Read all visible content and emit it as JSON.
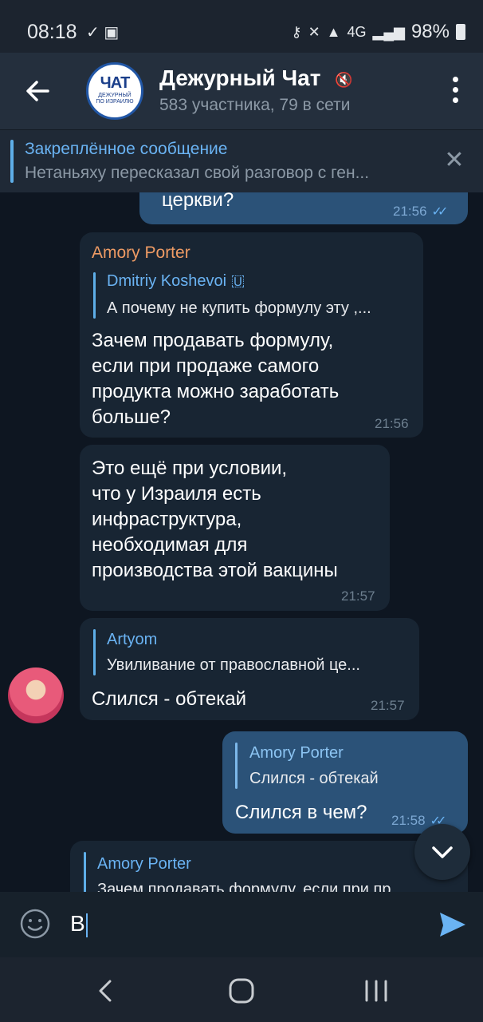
{
  "status": {
    "time": "08:18",
    "left_icons": "✓ ▣",
    "network": "4G",
    "battery": "98%"
  },
  "header": {
    "avatar_big": "ЧАТ",
    "avatar_small1": "ДЕЖУРНЫЙ",
    "avatar_small2": "ПО ИЗРАИЛЮ",
    "title": "Дежурный Чат",
    "subtitle": "583 участника, 79 в сети"
  },
  "pinned": {
    "title": "Закреплённое сообщение",
    "text": "Нетаньяху пересказал свой разговор с ген..."
  },
  "messages": {
    "m1": {
      "text": "церкви?",
      "time": "21:56"
    },
    "m2": {
      "author": "Amory Porter",
      "quote_name": "Dmitriy Koshevoi 🇺",
      "quote_text": "А почему не купить формулу эту ,...",
      "lines": [
        "Зачем продавать формулу,",
        "если при продаже самого",
        "продукта можно заработать",
        "больше?"
      ],
      "time": "21:56"
    },
    "m3": {
      "lines": [
        "Это ещё при условии,",
        "что у Израиля есть",
        "инфраструктура,",
        "необходимая для",
        "производства этой вакцины"
      ],
      "time": "21:57"
    },
    "m4": {
      "quote_name": "Artyom",
      "quote_text": "Увиливание от православной це...",
      "text": "Слился - обтекай",
      "time": "21:57"
    },
    "m5": {
      "quote_name": "Amory Porter",
      "quote_text": "Слился - обтекай",
      "text": "Слился в чем?",
      "time": "21:58"
    },
    "m6": {
      "quote_name": "Amory Porter",
      "quote_text": "Зачем продавать формулу, если при пр..."
    }
  },
  "composer": {
    "value": "В"
  },
  "colors": {
    "accent": "#6ab3f3",
    "author_orange": "#ee9b64",
    "out_bubble": "#2b5278",
    "in_bubble": "#182533"
  }
}
